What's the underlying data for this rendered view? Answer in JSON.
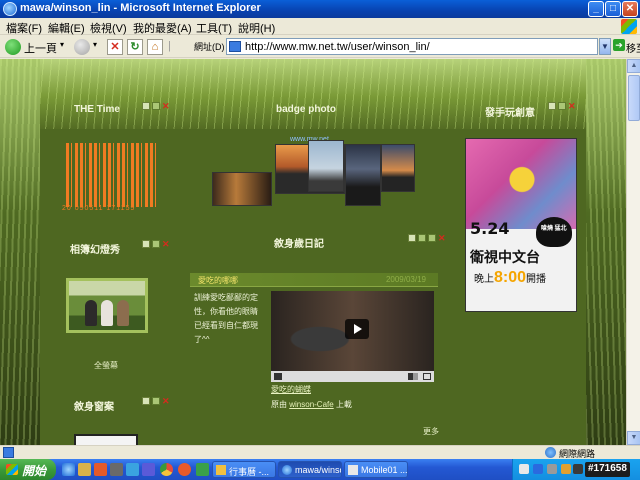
{
  "window": {
    "title": "mawa/winson_lin - Microsoft Internet Explorer"
  },
  "menu": [
    "檔案(F)",
    "編輯(E)",
    "檢視(V)",
    "我的最愛(A)",
    "工具(T)",
    "說明(H)"
  ],
  "toolbar": {
    "back_label": "上一頁",
    "address_label": "網址(D)",
    "url": "http://www.mw.net.tw/user/winson_lin/",
    "go_label": "移至"
  },
  "page": {
    "modules": {
      "time_title": "THE Time",
      "badge_title": "badge photo",
      "ad_title": "發手玩創意",
      "album_title": "相簿幻燈秀",
      "diary_title": "敘身歲日記",
      "bag_title": "敘身窗案"
    },
    "barcode_digits": "20 090511  171159",
    "badge_link": "www.mw.net",
    "album_link": "全螢幕",
    "diary": {
      "entry_title": "愛吃的哪哪",
      "entry_date": "2009/03/19",
      "body": "訓練愛吃鄙鄙的定性，你看他的眼睛已經看到自仁都現了^^",
      "video_link": "愛吃的蝴蝶",
      "source_prefix": "原由",
      "source_link": "winson-Cafe",
      "source_suffix": "上載",
      "more": "更多"
    },
    "ad": {
      "date": "5.24",
      "skull_text": "嗆燒\n猛北",
      "channel": "衛視中文台",
      "time_prefix": "晚上",
      "time": "8:00",
      "time_suffix": "開播"
    }
  },
  "statusbar": {
    "zone": "網際網路"
  },
  "taskbar": {
    "start": "開始",
    "buttons": [
      "行事曆 -...",
      "mawa/winso...",
      "Mobile01 ..."
    ],
    "clock": "#171658"
  }
}
